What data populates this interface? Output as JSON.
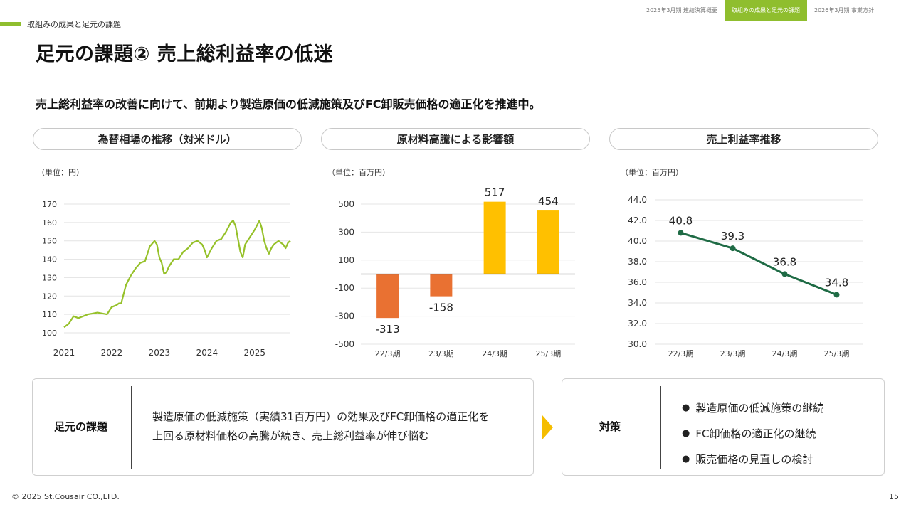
{
  "nav": {
    "tabs": [
      {
        "label": "2025年3月期 連結決算概要"
      },
      {
        "label": "取組みの成果と足元の課題"
      },
      {
        "label": "2026年3月期 事業方針"
      }
    ],
    "active_index": 1
  },
  "section_label": "取組みの成果と足元の課題",
  "title": "足元の課題② 売上総利益率の低迷",
  "lead": "売上総利益率の改善に向けて、前期より製造原価の低減施策及びFC卸販売価格の適正化を推進中。",
  "colors": {
    "accent_green": "#8fbe2e",
    "fx_line": "#96c12a",
    "bar_negative": "#e97132",
    "bar_positive": "#ffc000",
    "margin_line": "#1f6b45",
    "arrow": "#f5bd00"
  },
  "chart_data": [
    {
      "type": "line",
      "title": "為替相場の推移（対米ドル）",
      "unit": "（単位：円）",
      "x_ticks": [
        "2021",
        "2022",
        "2023",
        "2024",
        "2025"
      ],
      "y_ticks": [
        "170",
        "160",
        "150",
        "140",
        "130",
        "120",
        "110",
        "100"
      ],
      "ylim": [
        100,
        170
      ],
      "xlim": [
        2021.0,
        2025.75
      ],
      "grid": true,
      "series": [
        {
          "x": [
            2021.0,
            2021.1,
            2021.2,
            2021.3,
            2021.5,
            2021.7,
            2021.9,
            2022.0,
            2022.1,
            2022.15,
            2022.2,
            2022.3,
            2022.4,
            2022.5,
            2022.6,
            2022.7,
            2022.75,
            2022.8,
            2022.9,
            2022.95,
            2023.0,
            2023.05,
            2023.1,
            2023.15,
            2023.2,
            2023.3,
            2023.4,
            2023.5,
            2023.6,
            2023.7,
            2023.8,
            2023.9,
            2023.95,
            2024.0,
            2024.1,
            2024.2,
            2024.3,
            2024.4,
            2024.5,
            2024.55,
            2024.6,
            2024.7,
            2024.75,
            2024.8,
            2024.9,
            2025.0,
            2025.1,
            2025.15,
            2025.2,
            2025.25,
            2025.3,
            2025.35,
            2025.4,
            2025.5,
            2025.6,
            2025.65,
            2025.7,
            2025.75
          ],
          "values": [
            103,
            105,
            109,
            108,
            110,
            111,
            110,
            114,
            115,
            116,
            116,
            126,
            131,
            135,
            138,
            139,
            143,
            147,
            150,
            148,
            141,
            138,
            132,
            133,
            136,
            140,
            140,
            144,
            146,
            149,
            150,
            148,
            145,
            141,
            146,
            150,
            151,
            155,
            160,
            161,
            158,
            144,
            141,
            148,
            152,
            156,
            161,
            157,
            150,
            146,
            143,
            146,
            148,
            150,
            148,
            146,
            149,
            150
          ]
        }
      ]
    },
    {
      "type": "bar",
      "title": "原材料高騰による影響額",
      "unit": "（単位：百万円）",
      "categories": [
        "22/3期",
        "23/3期",
        "24/3期",
        "25/3期"
      ],
      "values": [
        -313,
        -158,
        517,
        454
      ],
      "data_labels": [
        "-313",
        "-158",
        "517",
        "454"
      ],
      "y_ticks": [
        "500",
        "300",
        "100",
        "-100",
        "-300",
        "-500"
      ],
      "ylim": [
        -500,
        500
      ],
      "grid": true
    },
    {
      "type": "line",
      "title": "売上利益率推移",
      "unit": "（単位：百万円）",
      "categories": [
        "22/3期",
        "23/3期",
        "24/3期",
        "25/3期"
      ],
      "values": [
        40.8,
        39.3,
        36.8,
        34.8
      ],
      "data_labels": [
        "40.8",
        "39.3",
        "36.8",
        "34.8"
      ],
      "y_ticks": [
        "44.0",
        "42.0",
        "40.0",
        "38.0",
        "36.0",
        "34.0",
        "32.0",
        "30.0"
      ],
      "ylim": [
        30,
        44
      ],
      "grid": true
    }
  ],
  "issue": {
    "heading": "足元の課題",
    "lines": [
      "製造原価の低減施策（実績31百万円）の効果及びFC卸価格の適正化を",
      "上回る原材料価格の高騰が続き、売上総利益率が伸び悩む"
    ]
  },
  "measures": {
    "heading": "対策",
    "bullet": "●",
    "items": [
      "製造原価の低減施策の継続",
      "FC卸価格の適正化の継続",
      "販売価格の見直しの検討"
    ]
  },
  "footer": {
    "copyright": "© 2025 St.Cousair CO.,LTD.",
    "page": "15"
  }
}
